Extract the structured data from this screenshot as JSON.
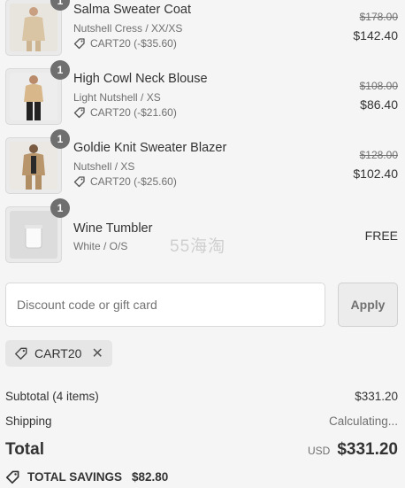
{
  "items": [
    {
      "name": "Salma Sweater Coat",
      "variant": "Nutshell Cress / XX/XS",
      "discount": "CART20 (-$35.60)",
      "price_old": "$178.00",
      "price_new": "$142.40",
      "quantity": "1"
    },
    {
      "name": "High Cowl Neck Blouse",
      "variant": "Light Nutshell / XS",
      "discount": "CART20 (-$21.60)",
      "price_old": "$108.00",
      "price_new": "$86.40",
      "quantity": "1"
    },
    {
      "name": "Goldie Knit Sweater Blazer",
      "variant": "Nutshell / XS",
      "discount": "CART20 (-$25.60)",
      "price_old": "$128.00",
      "price_new": "$102.40",
      "quantity": "1"
    },
    {
      "name": "Wine Tumbler",
      "variant": "White / O/S",
      "price": "FREE",
      "quantity": "1"
    }
  ],
  "watermark": "55海淘",
  "discount_form": {
    "placeholder": "Discount code or gift card",
    "apply_label": "Apply"
  },
  "applied_code": "CART20",
  "summary": {
    "subtotal_label": "Subtotal (4 items)",
    "subtotal_value": "$331.20",
    "shipping_label": "Shipping",
    "shipping_value": "Calculating...",
    "total_label": "Total",
    "currency": "USD",
    "total_value": "$331.20",
    "savings_label": "TOTAL SAVINGS",
    "savings_value": "$82.80"
  },
  "colors": {
    "background": "#f5f5f5",
    "badge": "#6f6f6f",
    "muted_text": "#707070"
  }
}
